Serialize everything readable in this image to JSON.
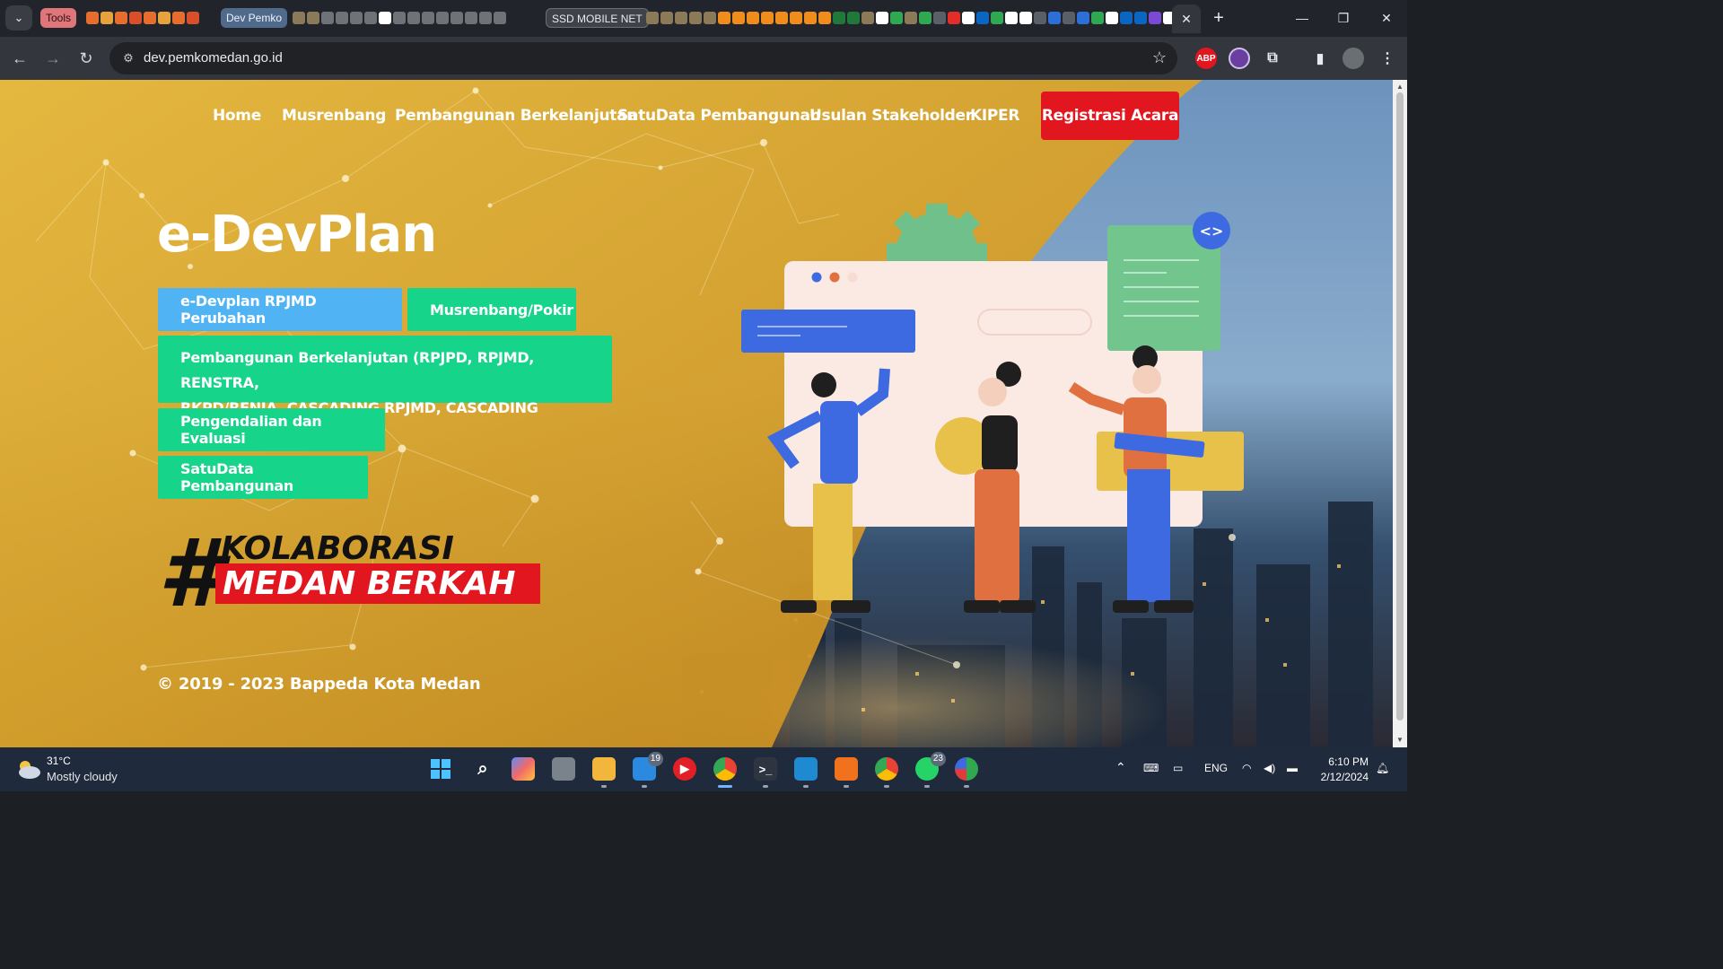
{
  "browser": {
    "tab_groups": {
      "tools": "Tools",
      "dev_pemko": "Dev Pemko",
      "ssd": "SSD MOBILE NET"
    },
    "url": "dev.pemkomedan.go.id",
    "extensions": {
      "adblock": "ABP"
    }
  },
  "site": {
    "nav": [
      {
        "label": "Home"
      },
      {
        "label": "Musrenbang"
      },
      {
        "label": "Pembangunan Berkelanjutan"
      },
      {
        "label": "SatuData Pembangunan"
      },
      {
        "label": "Usulan Stakeholder"
      },
      {
        "label": "KIPER"
      }
    ],
    "cta": "Registrasi Acara",
    "hero_title": "e-DevPlan",
    "buttons": {
      "rpjmd": "e-Devplan RPJMD Perubahan",
      "musrenbang": "Musrenbang/Pokir",
      "pembangunan_line1": "Pembangunan Berkelanjutan (RPJPD, RPJMD, RENSTRA,",
      "pembangunan_line2": "RKPD/RENJA, CASCADING RPJMD, CASCADING RENSTRA)",
      "pengendalian": "Pengendalian dan Evaluasi",
      "satudata": "SatuData Pembangunan"
    },
    "slogan": {
      "hash": "#",
      "line1": "KOLABORASI",
      "line2": "MEDAN BERKAH"
    },
    "code_badge": "<>",
    "copyright": "© 2019 - 2023 Bappeda Kota Medan"
  },
  "taskbar": {
    "weather": {
      "temp": "31°C",
      "desc": "Mostly cloudy"
    },
    "badges": {
      "mail": "19",
      "whatsapp": "23"
    },
    "language": "ENG",
    "time": "6:10 PM",
    "date": "2/12/2024"
  },
  "colors": {
    "cta_red": "#e1161e",
    "button_green": "#17d48b",
    "button_blue": "#4fb3f4",
    "yellow": "#e8b428"
  }
}
